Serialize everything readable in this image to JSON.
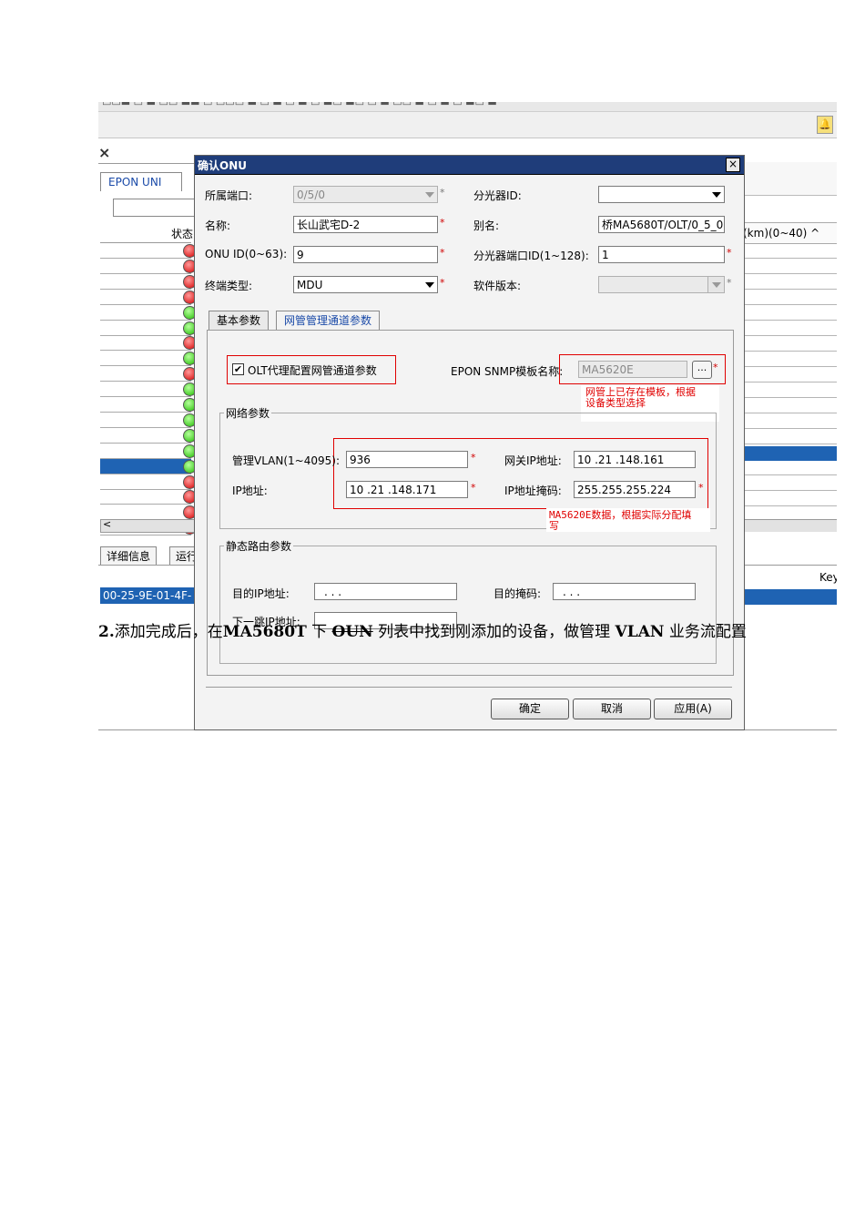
{
  "background_app": {
    "close_symbol": "×",
    "left_tab": "EPON UNI",
    "status_header": "状态",
    "right_header": "(km)(0~40) ^",
    "status_rows": [
      "red",
      "red",
      "red",
      "red",
      "green",
      "green",
      "red",
      "green",
      "red",
      "green",
      "green",
      "green",
      "green",
      "green",
      "selected",
      "red",
      "red",
      "red",
      "red"
    ],
    "bottom_tabs": [
      "详细信息",
      "运行"
    ],
    "selected_mac": "00-25-9E-01-4F-",
    "right_key_label": "Key"
  },
  "dialog": {
    "title": "确认ONU",
    "close_symbol": "×",
    "fields": {
      "port_label": "所属端口:",
      "port_value": "0/5/0",
      "splitter_id_label": "分光器ID:",
      "splitter_id_value": "",
      "name_label": "名称:",
      "name_value": "长山武宅D-2",
      "alias_label": "别名:",
      "alias_value": "桥MA5680T/OLT/0_5_0",
      "onu_id_label": "ONU ID(0~63):",
      "onu_id_value": "9",
      "splitter_port_label": "分光器端口ID(1~128):",
      "splitter_port_value": "1",
      "terminal_type_label": "终端类型:",
      "terminal_type_value": "MDU",
      "software_version_label": "软件版本:",
      "software_version_value": ""
    },
    "tabs": [
      "基本参数",
      "网管管理通道参数"
    ],
    "olt_proxy_label": "OLT代理配置网管通道参数",
    "olt_proxy_checked": "✔",
    "snmp_template_label": "EPON SNMP模板名称:",
    "snmp_template_value": "MA5620E",
    "browse_label": "...",
    "note_template": "网管上已存在模板，根据\n设备类型选择",
    "network_group_label": "网络参数",
    "mgmt_vlan_label": "管理VLAN(1~4095):",
    "mgmt_vlan_value": "936",
    "gateway_ip_label": "网关IP地址:",
    "gateway_ip_value": "10 .21 .148.161",
    "ip_label": "IP地址:",
    "ip_value": "10 .21 .148.171",
    "mask_label": "IP地址掩码:",
    "mask_value": "255.255.255.224",
    "note_data": "MA5620E数据，根据实际分配填\n写",
    "static_route_group_label": "静态路由参数",
    "dest_ip_label": "目的IP地址:",
    "dest_ip_value": ". . .",
    "dest_mask_label": "目的掩码:",
    "dest_mask_value": ". . .",
    "next_hop_label": "下一跳IP地址:",
    "buttons": {
      "ok": "确定",
      "cancel": "取消",
      "apply": "应用(A)"
    },
    "required_mark": "*"
  },
  "document": {
    "step_num": "2.",
    "t1": "添加完成后，在",
    "b1": "MA5680T",
    "t2": " 下 ",
    "b2": "OUN",
    "t3": " 列表中找到刚添加的设备，做管理 ",
    "b3": "VLAN",
    "t4": " 业务流配置"
  }
}
